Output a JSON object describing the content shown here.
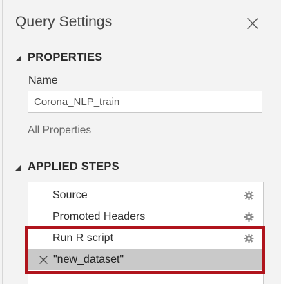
{
  "pane": {
    "title": "Query Settings",
    "close_icon": "close-icon"
  },
  "properties": {
    "header": "PROPERTIES",
    "name_label": "Name",
    "name_value": "Corona_NLP_train",
    "all_properties_link": "All Properties"
  },
  "applied_steps": {
    "header": "APPLIED STEPS",
    "steps": [
      {
        "label": "Source",
        "has_settings": true,
        "selected": false
      },
      {
        "label": "Promoted Headers",
        "has_settings": true,
        "selected": false
      },
      {
        "label": "Run R script",
        "has_settings": true,
        "selected": false
      },
      {
        "label": "\"new_dataset\"",
        "has_settings": false,
        "selected": true
      }
    ]
  },
  "colors": {
    "pane_background": "#f3f3f3",
    "selected_step": "#c9c9c9",
    "highlight_border": "#b0141c"
  }
}
